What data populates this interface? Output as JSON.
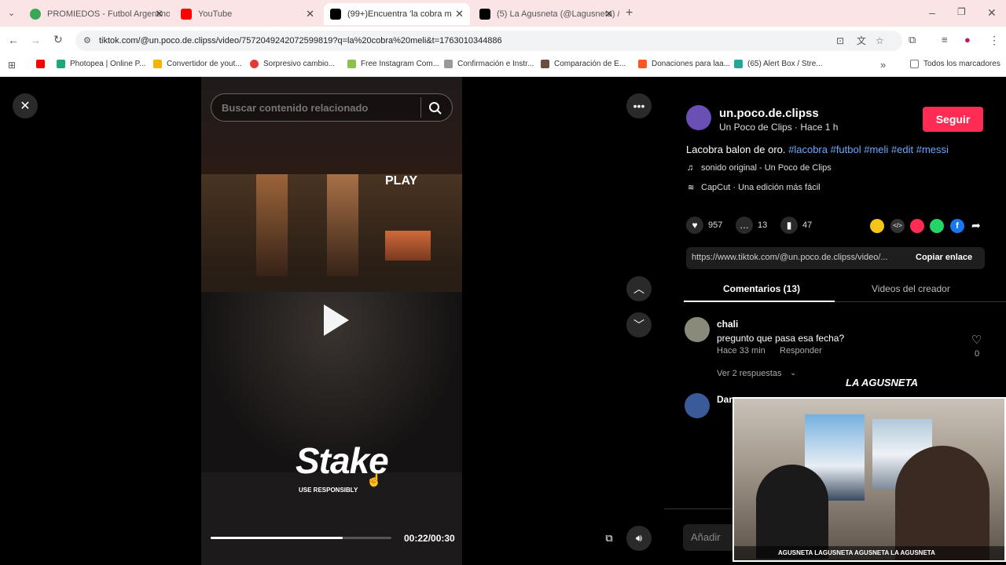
{
  "tabs": [
    {
      "label": "PROMIEDOS - Futbol Argentino",
      "color": "#3aa757"
    },
    {
      "label": "YouTube",
      "color": "#ff0000"
    },
    {
      "label": "(99+)Encuentra 'la cobra m",
      "color": "#000000"
    },
    {
      "label": "(5) La Agusneta (@Lagusneta) /",
      "color": "#000000"
    }
  ],
  "url": "tiktok.com/@un.poco.de.clipss/video/7572049242072599819?q=la%20cobra%20meli&t=1763010344886",
  "bookmarks": [
    "Photopea | Online P...",
    "Convertidor de yout...",
    "Sorpresivo cambio...",
    "Free Instagram Com...",
    "Confirmación e Instr...",
    "Comparación de E...",
    "Donaciones para laa...",
    "(65) Alert Box / Stre..."
  ],
  "bookmarks_all": "Todos los marcadores",
  "search": {
    "placeholder": "Buscar contenido relacionado"
  },
  "video": {
    "overlay_text": "PLAY",
    "sponsor": "Stake",
    "sponsor_sub": "USE RESPONSIBLY",
    "time": "00:22/00:30",
    "progress": 0.73
  },
  "creator": {
    "handle": "un.poco.de.clipss",
    "meta": "Un Poco de Clips · Hace 1 h",
    "follow_label": "Seguir",
    "caption": "Lacobra balon de oro.",
    "hashtags": "#lacobra #futbol #meli #edit #messi",
    "sound": "sonido original - Un Poco de Clips",
    "capcut": "CapCut · Una edición más fácil"
  },
  "stats": {
    "likes": "957",
    "comments": "13",
    "saves": "47"
  },
  "link": {
    "url": "https://www.tiktok.com/@un.poco.de.clipss/video/...",
    "copy_label": "Copiar enlace"
  },
  "panel_tabs": {
    "comments": "Comentarios (13)",
    "creator_videos": "Videos del creador"
  },
  "comments": [
    {
      "user": "chali",
      "text": "pregunto que pasa esa fecha?",
      "time": "Hace 33 min",
      "reply": "Responder",
      "likes": "0",
      "more": "Ver 2 respuestas"
    },
    {
      "user": "Dan"
    }
  ],
  "add_comment": "Añadir",
  "webcam": {
    "brand": "LA AGUSNETA",
    "social": "AGUSNETA   LAGUSNETA   AGUSNETA   LA AGUSNETA"
  }
}
